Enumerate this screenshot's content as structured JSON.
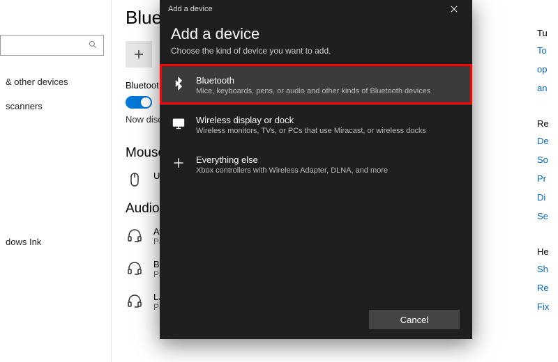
{
  "sidebar": {
    "items": [
      {
        "label": "& other devices"
      },
      {
        "label": "scanners"
      },
      {
        "label": "dows Ink"
      }
    ]
  },
  "main": {
    "page_title": "Bluetoo",
    "add_button_label": "Ad",
    "bluetooth_label": "Bluetoot",
    "bluetooth_toggle_on": true,
    "status_text": "Now disco",
    "sections": [
      {
        "heading": "Mouse,",
        "devices": [
          {
            "name": "US"
          }
        ]
      },
      {
        "heading": "Audio",
        "devices": [
          {
            "name": "Aw",
            "status": "Pai"
          },
          {
            "name": "BT",
            "status": "Pai"
          },
          {
            "name": "LJX",
            "status": "Pai"
          }
        ]
      }
    ]
  },
  "right": {
    "groups": [
      {
        "heading": "Tu",
        "links": [
          "To",
          "op",
          "an"
        ]
      },
      {
        "heading": "Re",
        "links": [
          "De",
          "So",
          "Pr",
          "Di",
          "Se"
        ]
      },
      {
        "heading": "He",
        "links": [
          "Sh",
          "Re",
          "Fix"
        ]
      }
    ]
  },
  "modal": {
    "window_title": "Add a device",
    "heading": "Add a device",
    "subheading": "Choose the kind of device you want to add.",
    "options": [
      {
        "title": "Bluetooth",
        "desc": "Mice, keyboards, pens, or audio and other kinds of Bluetooth devices"
      },
      {
        "title": "Wireless display or dock",
        "desc": "Wireless monitors, TVs, or PCs that use Miracast, or wireless docks"
      },
      {
        "title": "Everything else",
        "desc": "Xbox controllers with Wireless Adapter, DLNA, and more"
      }
    ],
    "cancel_label": "Cancel"
  },
  "colors": {
    "accent": "#0078d7",
    "modal_bg": "#1f1f1f",
    "annotation": "#ff0000"
  }
}
